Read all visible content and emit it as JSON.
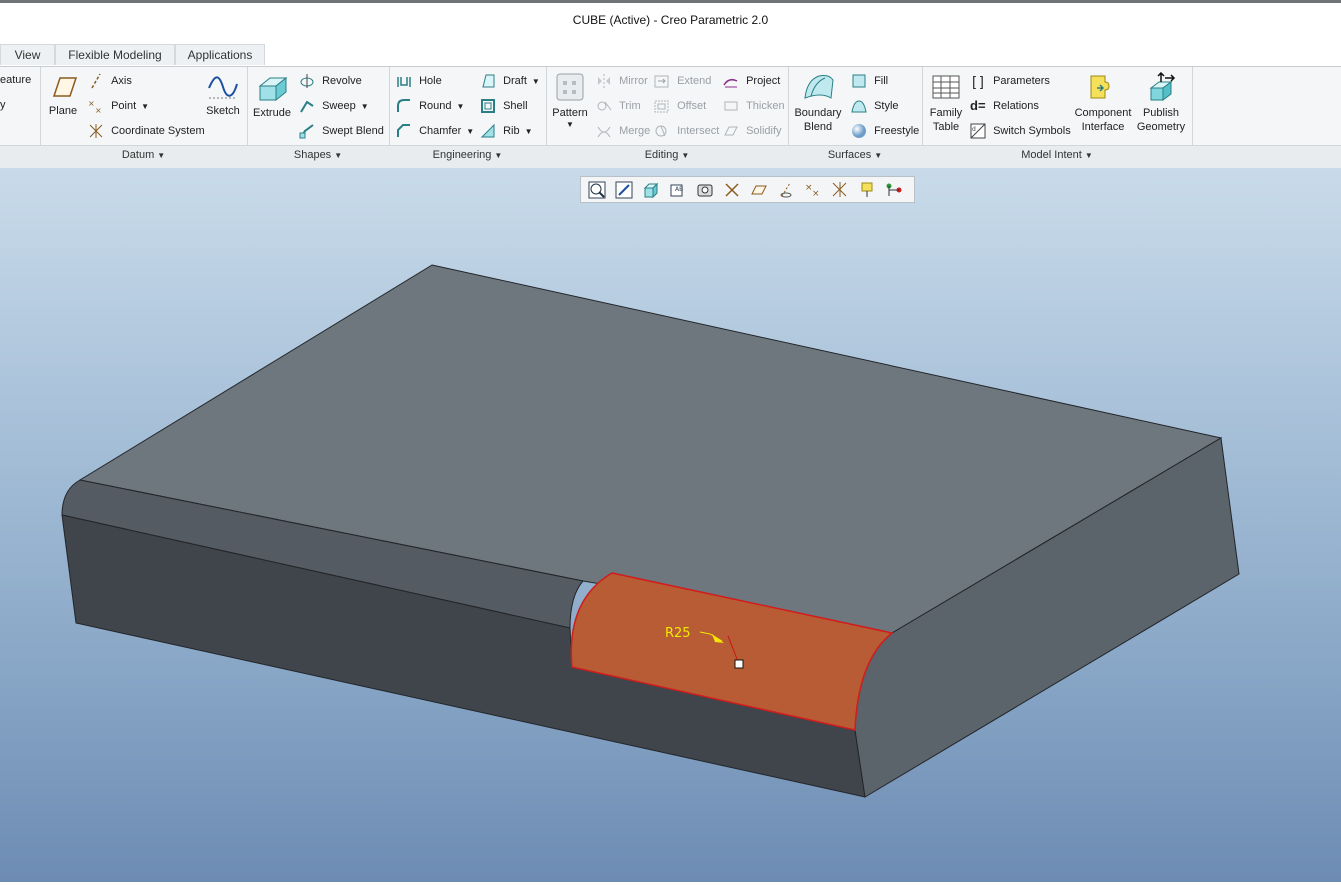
{
  "window": {
    "title": "CUBE (Active) - Creo Parametric 2.0"
  },
  "tabs": [
    {
      "label": "View"
    },
    {
      "label": "Flexible Modeling"
    },
    {
      "label": "Applications"
    }
  ],
  "ribbon": {
    "cut_left": {
      "line1": "eature",
      "line2": "y"
    },
    "datum": {
      "group_label": "Datum",
      "plane": "Plane",
      "axis": "Axis",
      "point": "Point",
      "coordinate_system": "Coordinate System",
      "sketch": "Sketch"
    },
    "shapes": {
      "group_label": "Shapes",
      "extrude": "Extrude",
      "revolve": "Revolve",
      "sweep": "Sweep",
      "swept_blend": "Swept Blend"
    },
    "engineering": {
      "group_label": "Engineering",
      "hole": "Hole",
      "round": "Round",
      "chamfer": "Chamfer",
      "draft": "Draft",
      "shell": "Shell",
      "rib": "Rib"
    },
    "editing": {
      "group_label": "Editing",
      "pattern": "Pattern",
      "mirror": "Mirror",
      "trim": "Trim",
      "merge": "Merge",
      "extend": "Extend",
      "offset": "Offset",
      "intersect": "Intersect",
      "project": "Project",
      "thicken": "Thicken",
      "solidify": "Solidify"
    },
    "surfaces": {
      "group_label": "Surfaces",
      "boundary_blend_1": "Boundary",
      "boundary_blend_2": "Blend",
      "fill": "Fill",
      "style": "Style",
      "freestyle": "Freestyle"
    },
    "model_intent": {
      "group_label": "Model Intent",
      "family_table_1": "Family",
      "family_table_2": "Table",
      "parameters": "Parameters",
      "relations": "Relations",
      "switch_symbols": "Switch Symbols",
      "component_interface_1": "Component",
      "component_interface_2": "Interface",
      "publish_geometry_1": "Publish",
      "publish_geometry_2": "Geometry"
    }
  },
  "viewport": {
    "dimension_label": "R25",
    "colors": {
      "top_face": "#6e767e",
      "front_face": "#40454c",
      "right_face": "#5b636b",
      "highlight_fill": "#b85c35",
      "highlight_edge": "#d21c1c",
      "dimension_text": "#f2e800"
    }
  },
  "view_toolbar": {
    "icons": [
      "refit-icon",
      "zoom-in-icon",
      "saved-orientation-icon",
      "display-style-icon",
      "view-manager-icon",
      "plane-display-icon",
      "axis-display-icon",
      "point-display-icon",
      "csys-display-icon",
      "spin-center-icon",
      "annotation-display-icon",
      "point-tag-icon",
      "csys-tag-icon"
    ]
  }
}
